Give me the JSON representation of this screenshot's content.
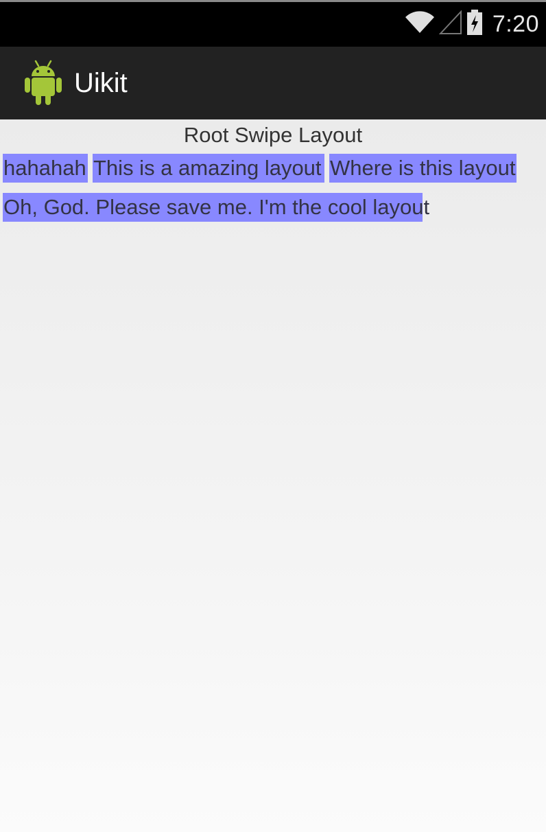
{
  "status_bar": {
    "time": "7:20",
    "icons": [
      "wifi-icon",
      "cell-signal-icon",
      "battery-charging-icon"
    ]
  },
  "action_bar": {
    "title": "Uikit",
    "icon": "android-icon"
  },
  "content": {
    "heading": "Root Swipe Layout",
    "tags": [
      "hahahah",
      "This is a amazing layout",
      "Where is this layout",
      "Oh, God. Please save me. I'm the cool layout"
    ]
  },
  "colors": {
    "action_bar_bg": "#222222",
    "status_bar_bg": "#000000",
    "tag_bg": "#8888ff",
    "content_bg": "#ebebeb"
  }
}
